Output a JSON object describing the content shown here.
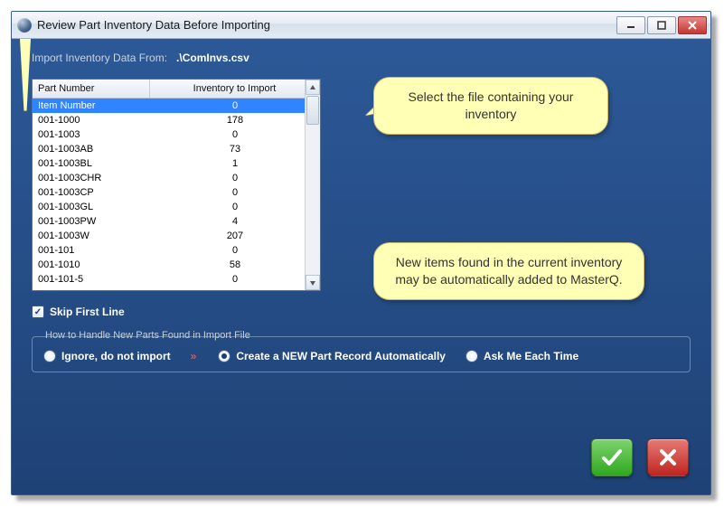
{
  "title": "Review Part Inventory Data Before Importing",
  "import": {
    "label": "Import Inventory Data From:",
    "file": ".\\ComInvs.csv"
  },
  "table": {
    "headers": {
      "part": "Part Number",
      "inv": "Inventory to Import"
    },
    "rows": [
      {
        "part": "Item Number",
        "inv": "0",
        "selected": true
      },
      {
        "part": "001-1000",
        "inv": "178"
      },
      {
        "part": "001-1003",
        "inv": "0"
      },
      {
        "part": "001-1003AB",
        "inv": "73"
      },
      {
        "part": "001-1003BL",
        "inv": "1"
      },
      {
        "part": "001-1003CHR",
        "inv": "0"
      },
      {
        "part": "001-1003CP",
        "inv": "0"
      },
      {
        "part": "001-1003GL",
        "inv": "0"
      },
      {
        "part": "001-1003PW",
        "inv": "4"
      },
      {
        "part": "001-1003W",
        "inv": "207"
      },
      {
        "part": "001-101",
        "inv": "0"
      },
      {
        "part": "001-1010",
        "inv": "58"
      },
      {
        "part": "001-101-5",
        "inv": "0"
      }
    ]
  },
  "skip_first": {
    "label": "Skip First Line",
    "checked": true
  },
  "group": {
    "legend": "How to Handle New Parts Found in Import File",
    "options": {
      "ignore": "Ignore, do not import",
      "create": "Create a NEW Part Record Automatically",
      "ask": "Ask Me Each Time"
    },
    "selected": "create"
  },
  "callouts": {
    "c1": "Select the file containing your inventory",
    "c2": "New items found in the current inventory may be automatically added to MasterQ."
  }
}
